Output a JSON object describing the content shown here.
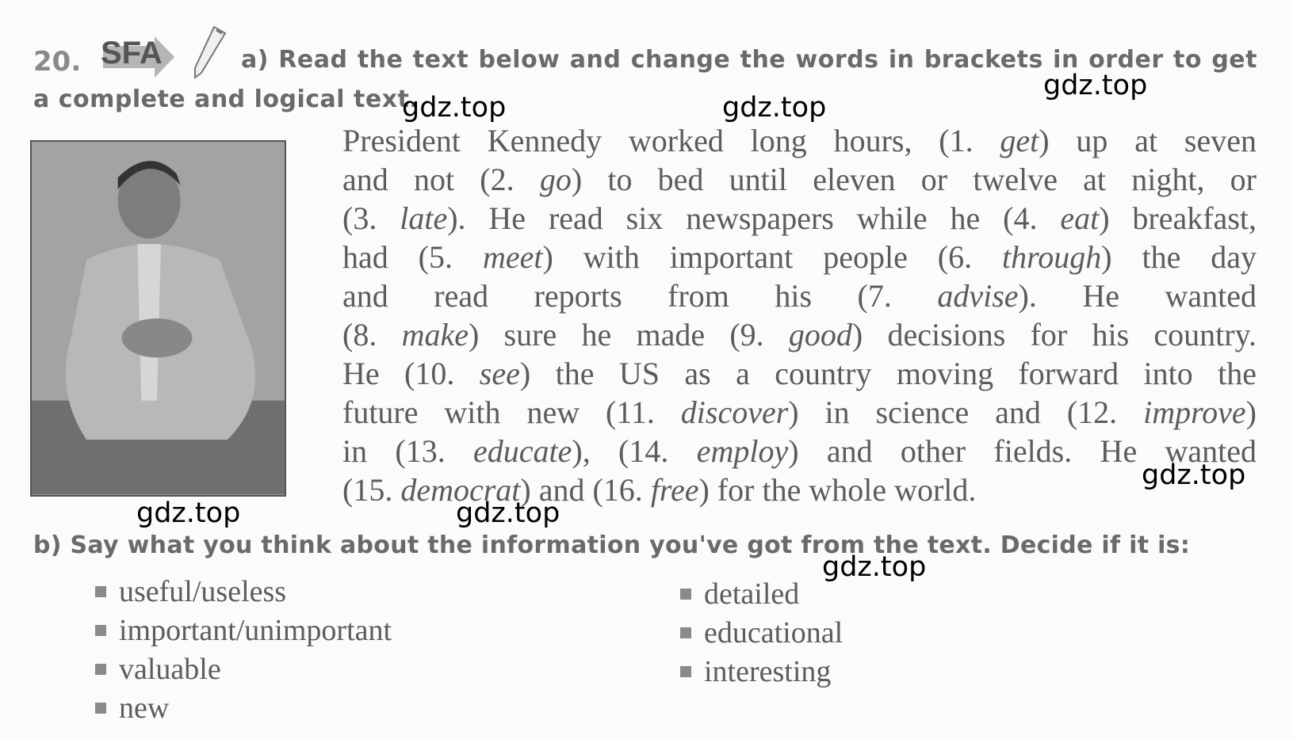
{
  "exercise": {
    "number": "20.",
    "badge": "SFA",
    "task_a_line1": "a) Read the text below and change the words in brackets in order to get",
    "task_a_line2": "a complete and logical text.",
    "task_b": "b) Say what you think about the information you've got from the text. Decide if it is:"
  },
  "paragraph_lines": [
    [
      {
        "t": "President Kennedy worked long hours, (1. "
      },
      {
        "t": "get",
        "i": true
      },
      {
        "t": ") up at seven"
      }
    ],
    [
      {
        "t": "and not (2. "
      },
      {
        "t": "go",
        "i": true
      },
      {
        "t": ") to bed until eleven or twelve at night, or"
      }
    ],
    [
      {
        "t": "(3. "
      },
      {
        "t": "late",
        "i": true
      },
      {
        "t": "). He read six newspapers while he (4. "
      },
      {
        "t": "eat",
        "i": true
      },
      {
        "t": ") breakfast,"
      }
    ],
    [
      {
        "t": "had (5. "
      },
      {
        "t": "meet",
        "i": true
      },
      {
        "t": ") with important people (6. "
      },
      {
        "t": "through",
        "i": true
      },
      {
        "t": ") the day"
      }
    ],
    [
      {
        "t": "and read reports from his (7. "
      },
      {
        "t": "advise",
        "i": true
      },
      {
        "t": "). He wanted"
      }
    ],
    [
      {
        "t": "(8. "
      },
      {
        "t": "make",
        "i": true
      },
      {
        "t": ") sure he made (9. "
      },
      {
        "t": "good",
        "i": true
      },
      {
        "t": ") decisions for his country."
      }
    ],
    [
      {
        "t": "He (10. "
      },
      {
        "t": "see",
        "i": true
      },
      {
        "t": ") the US as a country moving forward into the"
      }
    ],
    [
      {
        "t": "future with new (11. "
      },
      {
        "t": "discover",
        "i": true
      },
      {
        "t": ") in science and (12. "
      },
      {
        "t": "improve",
        "i": true
      },
      {
        "t": ")"
      }
    ],
    [
      {
        "t": "in (13. "
      },
      {
        "t": "educate",
        "i": true
      },
      {
        "t": "), (14. "
      },
      {
        "t": "employ",
        "i": true
      },
      {
        "t": ") and other fields. He wanted"
      }
    ],
    [
      {
        "t": "(15. "
      },
      {
        "t": "democrat",
        "i": true
      },
      {
        "t": ") and (16. "
      },
      {
        "t": "free",
        "i": true
      },
      {
        "t": ") for the whole world."
      }
    ]
  ],
  "options_left": [
    "useful/useless",
    "important/unimportant",
    "valuable",
    "new"
  ],
  "options_right": [
    "detailed",
    "educational",
    "interesting"
  ],
  "watermark": "gdz.top"
}
